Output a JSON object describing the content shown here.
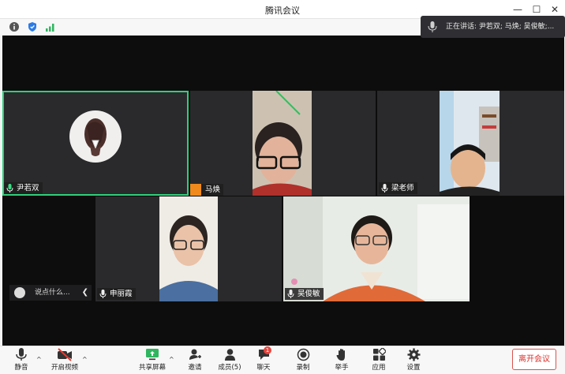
{
  "window": {
    "title": "腾讯会议"
  },
  "speaking_banner": {
    "text": "正在讲话: 尹若双; 马焕; 吴俊敏;..."
  },
  "participants": [
    {
      "name": "尹若双"
    },
    {
      "name": "马焕"
    },
    {
      "name": "梁老师"
    },
    {
      "name": "申丽霞"
    },
    {
      "name": "吴俊敏"
    }
  ],
  "chat": {
    "placeholder": "说点什么..."
  },
  "toolbar": {
    "mute": "静音",
    "video": "开启视频",
    "share": "共享屏幕",
    "invite": "邀请",
    "members": "成员(5)",
    "chat": "聊天",
    "chat_badge": "1",
    "record": "录制",
    "raise_hand": "举手",
    "apps": "应用",
    "settings": "设置",
    "leave": "离开会议"
  },
  "colors": {
    "active_border": "#2fcf7a",
    "leave": "#d8322d",
    "background": "#0d0d0d"
  }
}
